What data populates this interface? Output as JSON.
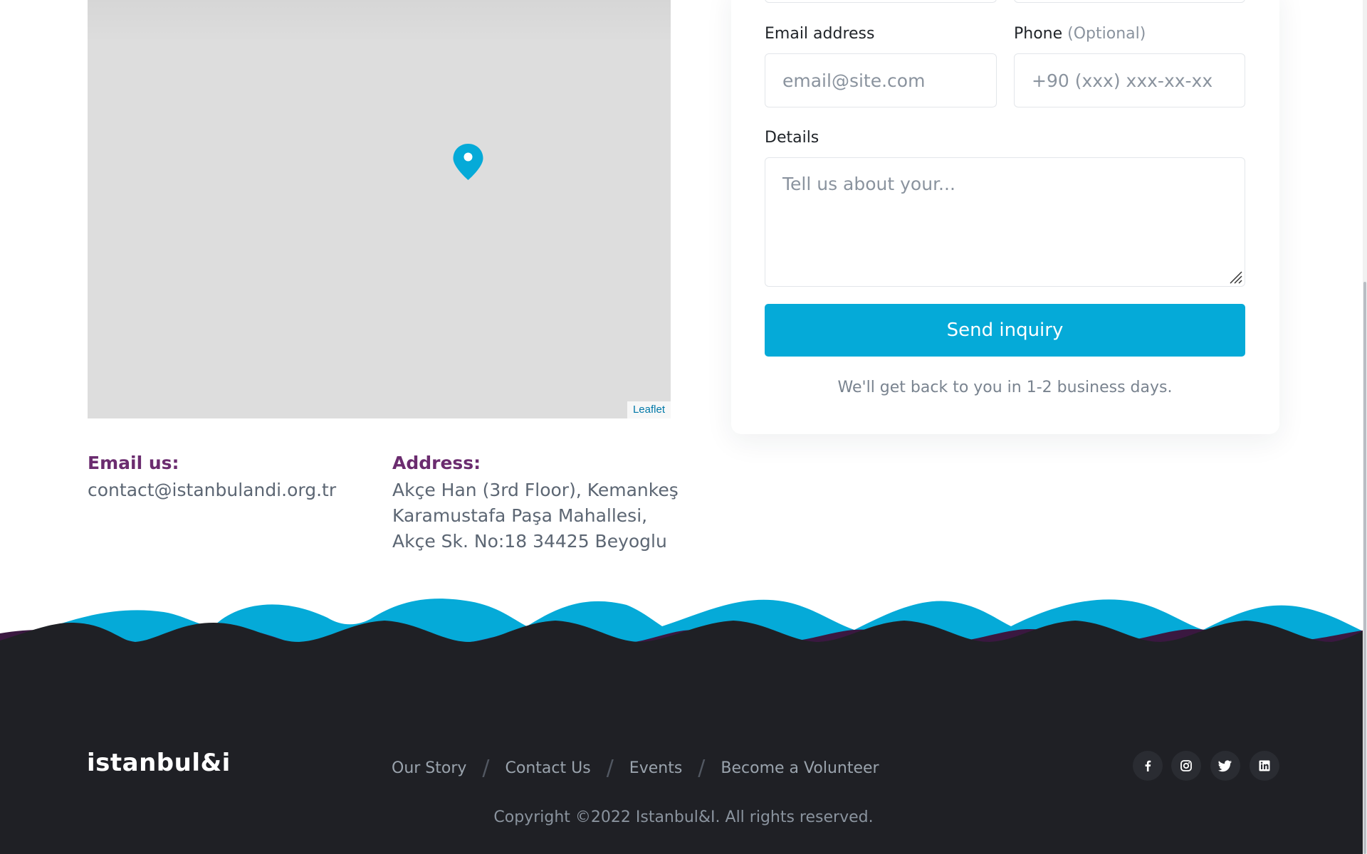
{
  "map": {
    "attribution": "Leaflet",
    "pin_color": "#05aad8"
  },
  "contact": {
    "email_label": "Email us:",
    "email_value": "contact@istanbulandi.org.tr",
    "address_label": "Address:",
    "address_value": "Akçe Han (3rd Floor), Kemankeş Karamustafa Paşa Mahallesi, Akçe Sk. No:18 34425 Beyoglu"
  },
  "form": {
    "email_label": "Email address",
    "email_placeholder": "email@site.com",
    "phone_label": "Phone",
    "phone_optional": "(Optional)",
    "phone_placeholder": "+90 (xxx) xxx-xx-xx",
    "details_label": "Details",
    "details_placeholder": "Tell us about your...",
    "submit_label": "Send inquiry",
    "note": "We'll get back to you in 1-2 business days."
  },
  "footer": {
    "logo": "istanbul&i",
    "nav": [
      "Our Story",
      "Contact Us",
      "Events",
      "Become a Volunteer"
    ],
    "separator": "/",
    "social_icons": [
      "facebook-icon",
      "instagram-icon",
      "twitter-icon",
      "linkedin-icon"
    ],
    "copyright": "Copyright ©2022 Istanbul&I. All rights reserved."
  },
  "colors": {
    "accent": "#05aad8",
    "purple": "#6b2c6f",
    "footer_bg": "#1f2025",
    "wave_purple": "#3a1840"
  }
}
